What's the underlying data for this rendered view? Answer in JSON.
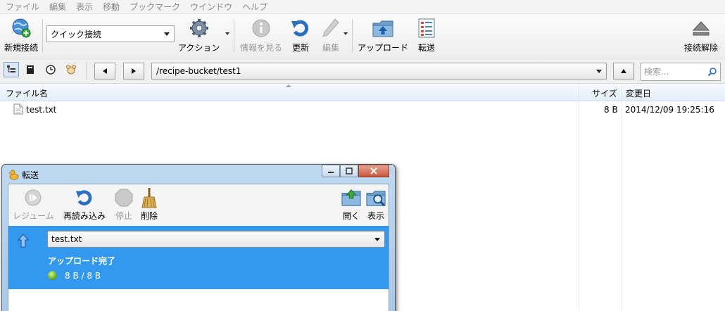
{
  "menu": [
    "ファイル",
    "編集",
    "表示",
    "移動",
    "ブックマーク",
    "ウインドウ",
    "ヘルプ"
  ],
  "toolbar": {
    "new_connection": "新規接続",
    "quick_connect": "クイック接続",
    "action": "アクション",
    "info": "情報を見る",
    "refresh": "更新",
    "edit": "編集",
    "upload": "アップロード",
    "transfer": "転送",
    "disconnect": "接続解除"
  },
  "nav": {
    "path": "/recipe-bucket/test1",
    "search_placeholder": "検索..."
  },
  "list": {
    "headers": {
      "name": "ファイル名",
      "size": "サイズ",
      "modified": "変更日"
    },
    "rows": [
      {
        "name": "test.txt",
        "size": "8 B",
        "modified": "2014/12/09 19:25:16"
      }
    ]
  },
  "transfer_window": {
    "title": "転送",
    "toolbar": {
      "resume": "レジューム",
      "reload": "再読み込み",
      "stop": "停止",
      "delete": "削除",
      "open": "開く",
      "show": "表示"
    },
    "item": {
      "file": "test.txt",
      "status": "アップロード完了",
      "progress": "8 B / 8 B"
    }
  },
  "colors": {
    "selection": "#3399ee",
    "window_frame": "#a8c8e8",
    "header_bg": "#e3eef9"
  }
}
